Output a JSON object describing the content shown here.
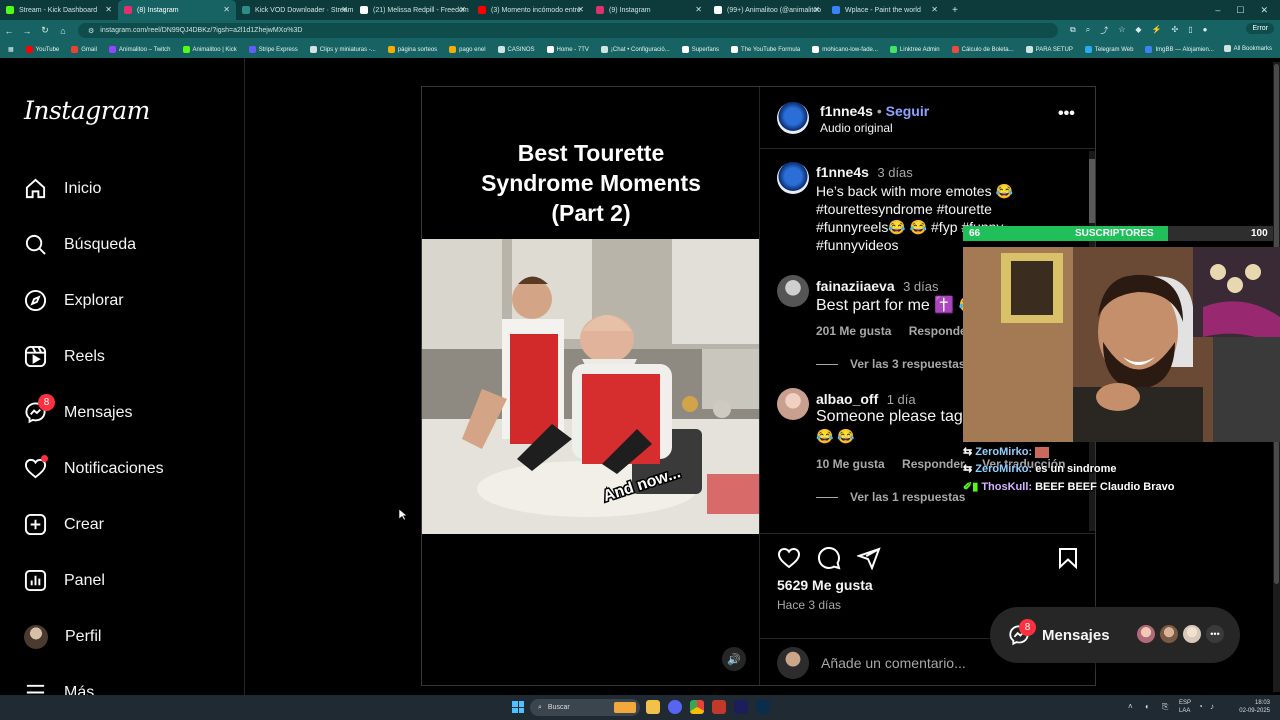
{
  "browser": {
    "tabs": [
      {
        "title": "Stream - Kick Dashboard",
        "color": "#53fc18"
      },
      {
        "title": "(8) Instagram",
        "color": "#e1306c",
        "active": true
      },
      {
        "title": "Kick VOD Downloader · Stream",
        "color": "#2c8c8c"
      },
      {
        "title": "(21) Melissa Redpill - Freedom",
        "color": "#ffffff"
      },
      {
        "title": "(3) Momento incómodo entre",
        "color": "#ff0000"
      },
      {
        "title": "(9) Instagram",
        "color": "#e1306c"
      },
      {
        "title": "(99+) Animalitoo (@animalitoo",
        "color": "#ffffff"
      },
      {
        "title": "Wplace - Paint the world",
        "color": "#3b82f6"
      }
    ],
    "url": "instagram.com/reel/DN99QJ4DBKz/?igsh=a2l1d1ZhejwMXo%3D",
    "profile_label": "Error",
    "bookmarks": [
      "YouTube",
      "Gmail",
      "Animalitoo – Twitch",
      "Animalitoo | Kick",
      "Stripe Express",
      "Clips y miniaturas -...",
      "página sorteos",
      "pago enel",
      "CASINOS",
      "Home - 7TV",
      "¡Chat • Configuració...",
      "Superfans",
      "The YouTube Formula",
      "mohicano-low-fade...",
      "Linktree Admin",
      "Cálculo de Boleta...",
      "PARA SETUP",
      "Telegram Web",
      "ImgBB — Alojamien..."
    ],
    "all_bookmarks": "All Bookmarks"
  },
  "sidebar": {
    "logo": "Instagram",
    "items": [
      {
        "label": "Inicio"
      },
      {
        "label": "Búsqueda"
      },
      {
        "label": "Explorar"
      },
      {
        "label": "Reels"
      },
      {
        "label": "Mensajes",
        "badge": "8"
      },
      {
        "label": "Notificaciones"
      },
      {
        "label": "Crear"
      },
      {
        "label": "Panel"
      },
      {
        "label": "Perfil"
      },
      {
        "label": "Más"
      }
    ]
  },
  "post": {
    "video_title": [
      "Best Tourette",
      "Syndrome Moments",
      "(Part 2)"
    ],
    "video_overlay_text": "And now...",
    "author": "f1nne4s",
    "follow": "Seguir",
    "audio": "Audio original",
    "caption": {
      "user": "f1nne4s",
      "time": "3 días",
      "text": "He’s back with more emotes 😂",
      "hashtags_1": "#tourettesyndrome #tourette",
      "hashtags_2": "#funnyreels😂 😂 #fyp #funny",
      "hashtags_3": "#funnyvideos"
    },
    "comments": [
      {
        "user": "fainaziiaeva",
        "time": "3 días",
        "text": "Best part for me ✝️ 😂",
        "likes": "201 Me gusta",
        "reply": "Responder",
        "view_replies": "Ver las 3 respuestas"
      },
      {
        "user": "albao_off",
        "time": "1 día",
        "text": "Someone please tag",
        "text2": "😂 😂",
        "likes": "10 Me gusta",
        "reply": "Responder",
        "translate": "Ver traducción",
        "view_replies": "Ver las 1 respuestas"
      }
    ],
    "likes_count": "5629 Me gusta",
    "posted": "Hace 3 días",
    "add_comment_placeholder": "Añade un comentario..."
  },
  "overlay": {
    "sub_current": "66",
    "sub_label": "SUSCRIPTORES",
    "sub_goal": "100",
    "sub_progress": 0.66,
    "chat": [
      {
        "user": "ZeroMirko:",
        "text": ""
      },
      {
        "user": "ZeroMirko:",
        "text": "es un sindrome"
      },
      {
        "user": "ThosKull:",
        "text": "BEEF BEEF Claudio Bravo"
      }
    ]
  },
  "messages_pill": {
    "label": "Mensajes",
    "badge": "8"
  },
  "taskbar": {
    "search": "Buscar",
    "lang": "ESP",
    "lang2": "LAA",
    "time": "18:03",
    "date": "02-09-2025"
  }
}
